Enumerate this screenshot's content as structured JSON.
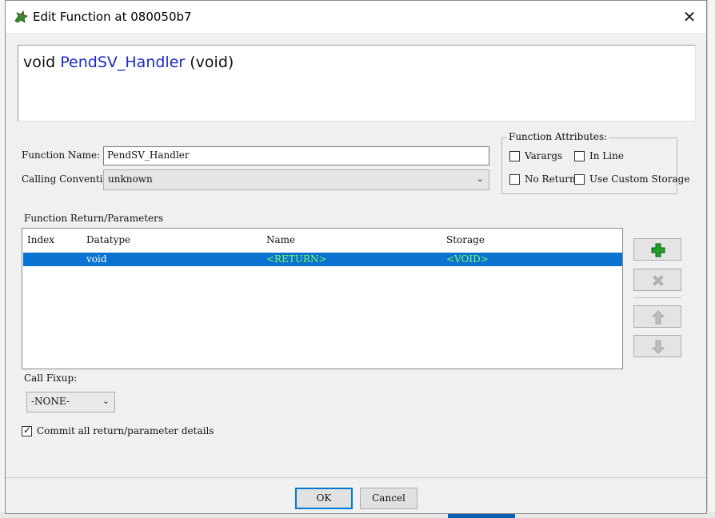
{
  "window": {
    "title": "Edit Function at 080050b7",
    "close_glyph": "✕"
  },
  "signature": {
    "return_type": "void",
    "name": "PendSV_Handler",
    "params": "(void)"
  },
  "form": {
    "function_name_label": "Function Name:",
    "function_name_value": "PendSV_Handler",
    "calling_convention_label": "Calling Convention",
    "calling_convention_value": "unknown"
  },
  "attributes": {
    "legend": "Function Attributes:",
    "varargs": {
      "label": "Varargs",
      "checked": false
    },
    "inline": {
      "label": "In Line",
      "checked": false
    },
    "no_return": {
      "label": "No Return",
      "checked": false
    },
    "custom_storage": {
      "label": "Use Custom Storage",
      "checked": false
    }
  },
  "params_table": {
    "section_label": "Function Return/Parameters",
    "columns": [
      "Index",
      "Datatype",
      "Name",
      "Storage"
    ],
    "rows": [
      {
        "index": "",
        "datatype": "void",
        "name": "<RETURN>",
        "storage": "<VOID>",
        "selected": true
      }
    ]
  },
  "side_buttons": {
    "add": "add-icon",
    "remove": "remove-icon",
    "up": "arrow-up-icon",
    "down": "arrow-down-icon"
  },
  "call_fixup": {
    "label": "Call Fixup:",
    "value": "-NONE-"
  },
  "commit": {
    "label": "Commit all return/parameter details",
    "checked": true
  },
  "buttons": {
    "ok": "OK",
    "cancel": "Cancel"
  },
  "colors": {
    "accent_selection": "#0a72d1",
    "signature_name": "#1b2bc8",
    "highlight_text": "#7dff5a",
    "add_icon": "#1e9e2a"
  }
}
